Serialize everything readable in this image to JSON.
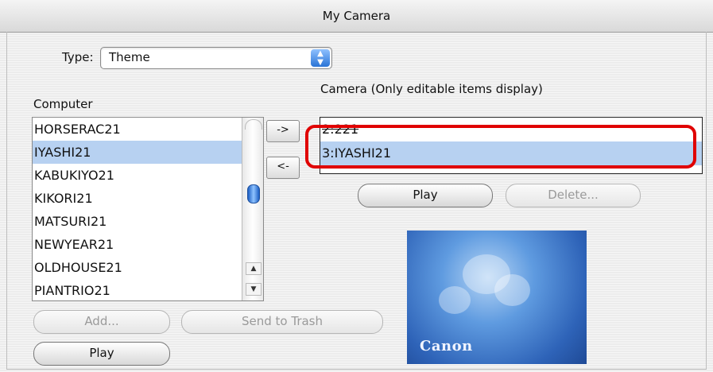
{
  "window": {
    "title": "My Camera"
  },
  "type_selector": {
    "label": "Type:",
    "value": "Theme"
  },
  "computer_panel": {
    "label": "Computer",
    "items": [
      "HORSERAC21",
      "IYASHI21",
      "KABUKIYO21",
      "KIKORI21",
      "MATSURI21",
      "NEWYEAR21",
      "OLDHOUSE21",
      "PIANTRIO21"
    ],
    "selected_index": 1,
    "add_label": "Add...",
    "trash_label": "Send to Trash",
    "play_label": "Play"
  },
  "transfer": {
    "to_camera": "->",
    "to_computer": "<-"
  },
  "camera_panel": {
    "label": "Camera (Only editable items display)",
    "items": [
      "2:221",
      "3:IYASHI21"
    ],
    "selected_index": 1,
    "play_label": "Play",
    "delete_label": "Delete..."
  },
  "preview": {
    "logo_text": "Canon"
  }
}
